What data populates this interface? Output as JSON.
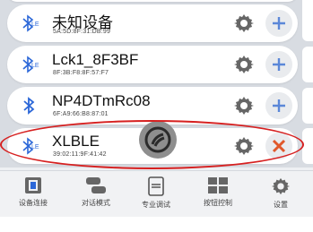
{
  "devices": [
    {
      "name": "未知设备",
      "mac": "5A:5D:8F:31:DB:99",
      "bt_icon": "bluetooth-le-icon",
      "action": "add"
    },
    {
      "name": "Lck1_8F3BF",
      "mac": "8F:3B:F8:8F:57:F7",
      "bt_icon": "bluetooth-le-icon",
      "action": "add"
    },
    {
      "name": "NP4DTmRc08",
      "mac": "6F:A9:66:B8:87:01",
      "bt_icon": "bluetooth-icon",
      "action": "add"
    },
    {
      "name": "XLBLE",
      "mac": "39:02:11:9F:41:42",
      "bt_icon": "bluetooth-le-icon",
      "action": "remove"
    }
  ],
  "nav": [
    {
      "label": "设备连接",
      "icon": "device-connect-icon"
    },
    {
      "label": "对话模式",
      "icon": "chat-icon"
    },
    {
      "label": "专业调试",
      "icon": "debug-icon"
    },
    {
      "label": "按钮控制",
      "icon": "button-grid-icon"
    },
    {
      "label": "设置",
      "icon": "gear-icon"
    }
  ],
  "colors": {
    "bluetooth": "#2b67d8",
    "gear": "#666666",
    "add": "#5b87d8",
    "remove": "#e0582b",
    "highlight": "#d62020"
  }
}
